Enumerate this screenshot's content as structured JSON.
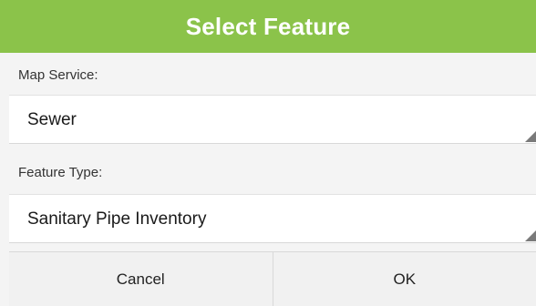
{
  "dialog": {
    "title": "Select Feature",
    "accent_color": "#8bc34a"
  },
  "map_service": {
    "label": "Map Service:",
    "value": "Sewer"
  },
  "feature_type": {
    "label": "Feature Type:",
    "value": "Sanitary Pipe Inventory"
  },
  "buttons": {
    "cancel": "Cancel",
    "ok": "OK"
  }
}
